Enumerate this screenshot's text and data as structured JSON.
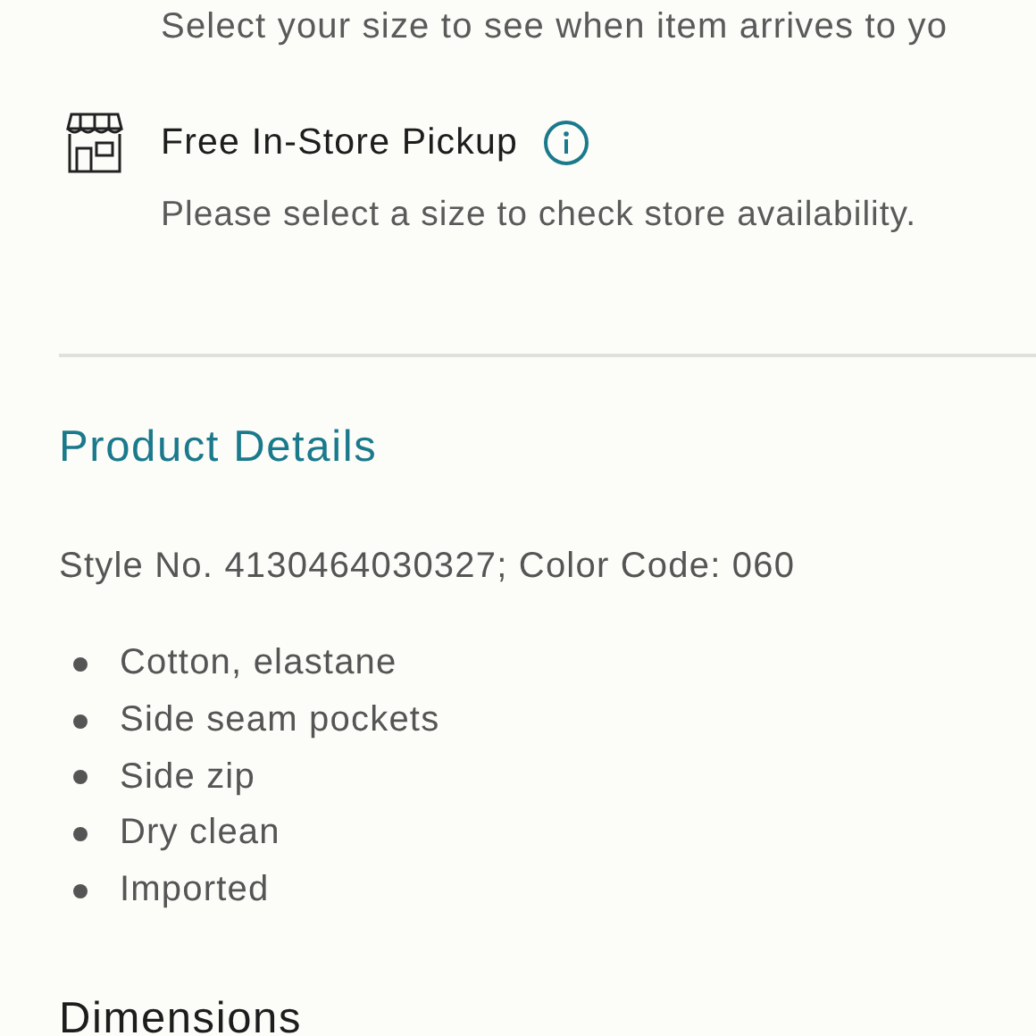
{
  "delivery_note": "Select your size to see when item arrives to yo",
  "pickup": {
    "title": "Free In-Store Pickup",
    "note": "Please select a size to check store availability."
  },
  "product_details": {
    "heading": "Product Details",
    "style_line": "Style No. 4130464030327; Color Code: 060",
    "features": [
      "Cotton, elastane",
      "Side seam pockets",
      "Side zip",
      "Dry clean",
      "Imported"
    ]
  },
  "dimensions": {
    "heading": "Dimensions"
  }
}
